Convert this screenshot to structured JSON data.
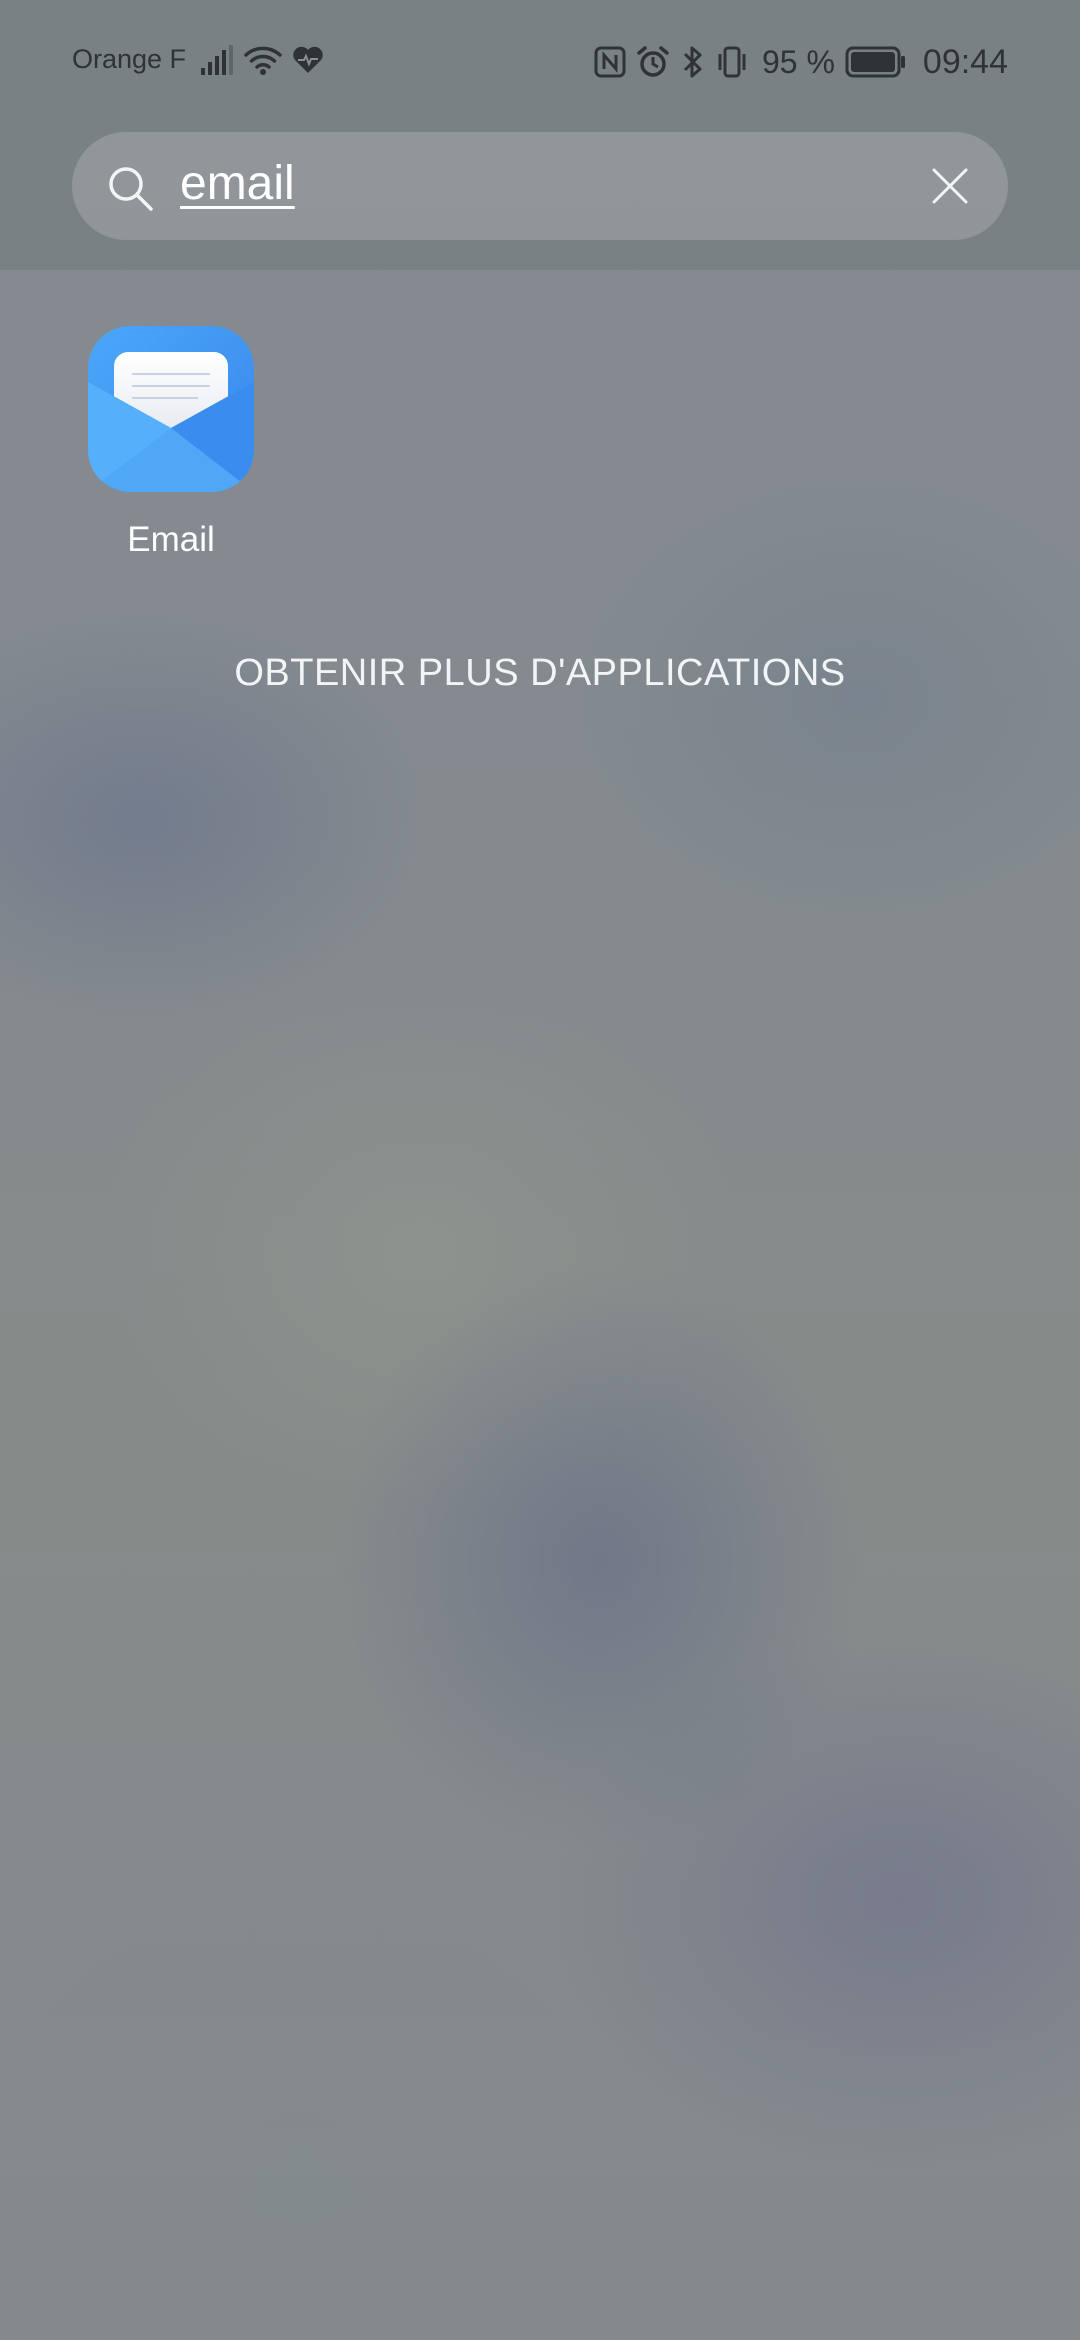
{
  "status_bar": {
    "carrier": "Orange F",
    "battery_percent": "95 %",
    "time": "09:44",
    "icons": [
      "signal-icon",
      "wifi-icon",
      "health-icon",
      "nfc-icon",
      "alarm-icon",
      "bluetooth-icon",
      "vibrate-icon",
      "battery-icon"
    ]
  },
  "search": {
    "query": "email",
    "icon": "search-icon",
    "clear_icon": "close-icon"
  },
  "results": {
    "apps": [
      {
        "label": "Email",
        "icon": "email-app-icon"
      }
    ],
    "more_apps_label": "OBTENIR PLUS D'APPLICATIONS"
  },
  "colors": {
    "text_primary": "#ffffff",
    "status_text": "#2f3236",
    "email_icon_blue": "#3d8ef0"
  }
}
